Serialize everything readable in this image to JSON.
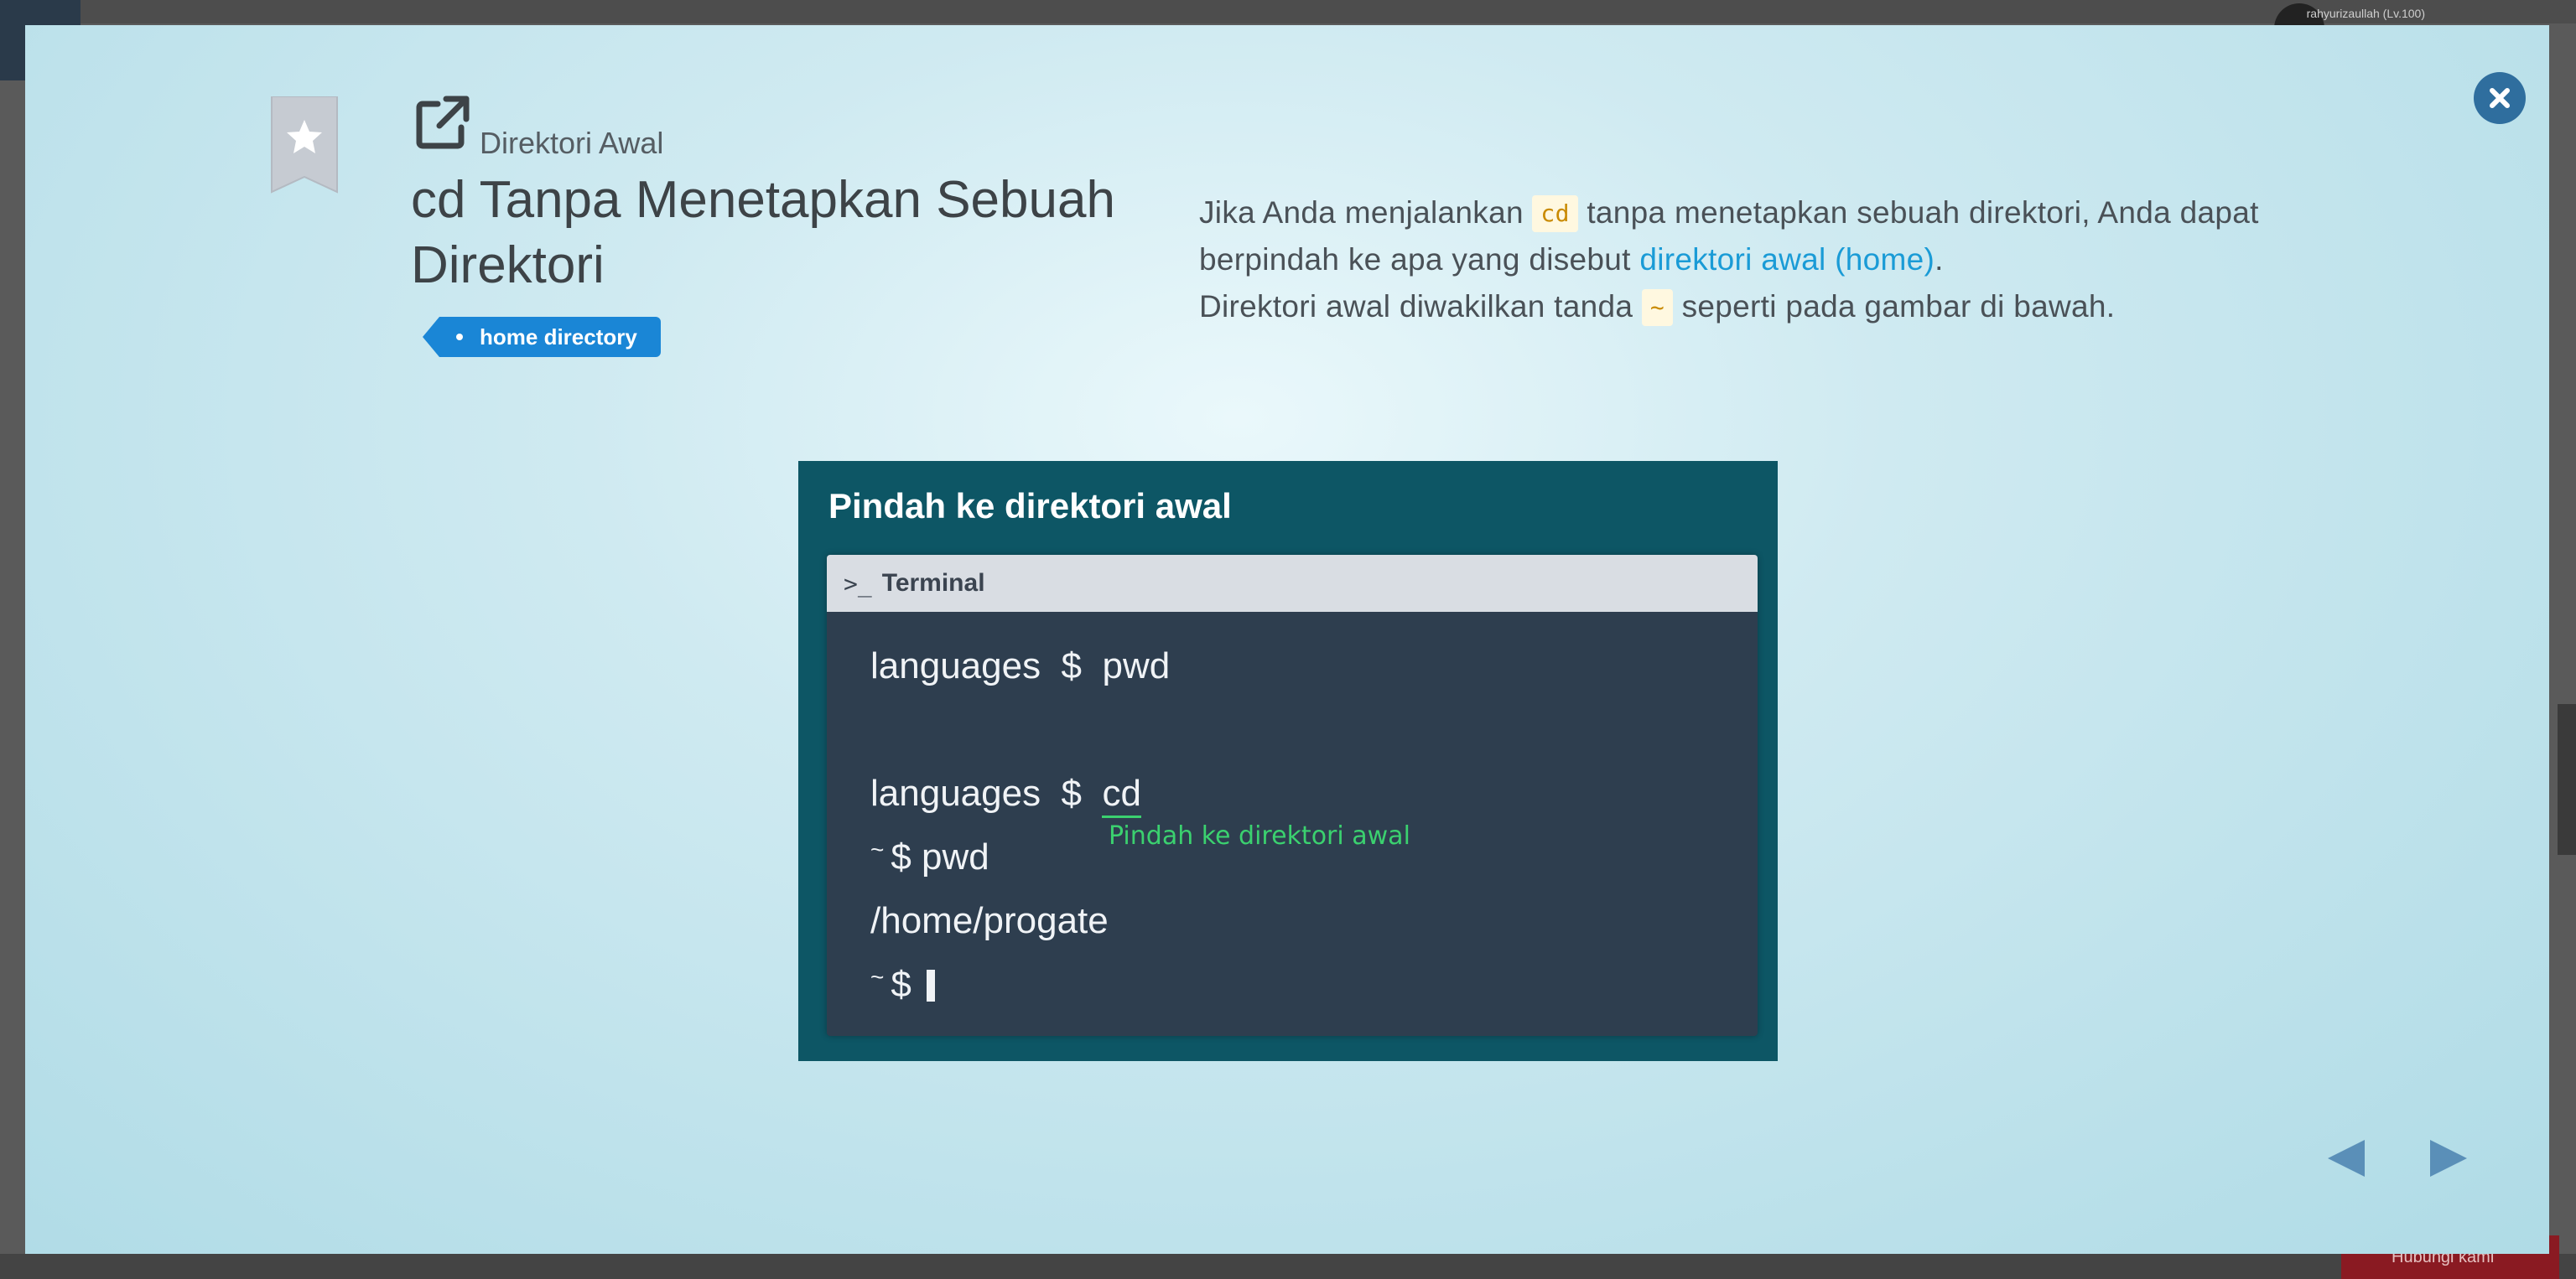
{
  "background": {
    "user_label": "rahyurizaullah (Lv.100)",
    "help_label": "Hubungi kami"
  },
  "modal": {
    "category": "Direktori Awal",
    "title": "cd Tanpa Menetapkan Sebuah Direktori",
    "tag": "home directory",
    "description": {
      "part1": "Jika Anda menjalankan ",
      "code1": "cd",
      "part2": " tanpa menetapkan sebuah direktori, Anda dapat berpindah ke apa yang disebut ",
      "link": "direktori awal (home)",
      "part3": ".",
      "part4": "Direktori awal diwakilkan tanda ",
      "code2": "~",
      "part5": " seperti pada gambar di bawah."
    },
    "slide": {
      "title": "Pindah ke direktori awal",
      "terminal_title": "Terminal",
      "prompt_icon": ">_",
      "lines": {
        "l1_dir": "languages",
        "l1_prompt": "$",
        "l1_cmd": "pwd",
        "l2_dir": "languages",
        "l2_prompt": "$",
        "l2_cmd": "cd",
        "l3_tilde": "~",
        "l3_rest": "$ pwd",
        "l4_output": "/home/progate",
        "l5_tilde": "~",
        "l5_prompt": "$"
      },
      "annotation": "Pindah ke direktori awal"
    }
  },
  "colors": {
    "accent": "#1a86d6",
    "link": "#1a9bd6",
    "close": "#2f6e9e",
    "slide_bg": "#0d5665",
    "terminal_bg": "#2e3e4f",
    "annotation": "#3bd16f"
  },
  "icons": {
    "close": "close-icon",
    "bookmark": "bookmark-star-icon",
    "external": "external-link-icon",
    "prev": "arrow-left-icon",
    "next": "arrow-right-icon"
  }
}
